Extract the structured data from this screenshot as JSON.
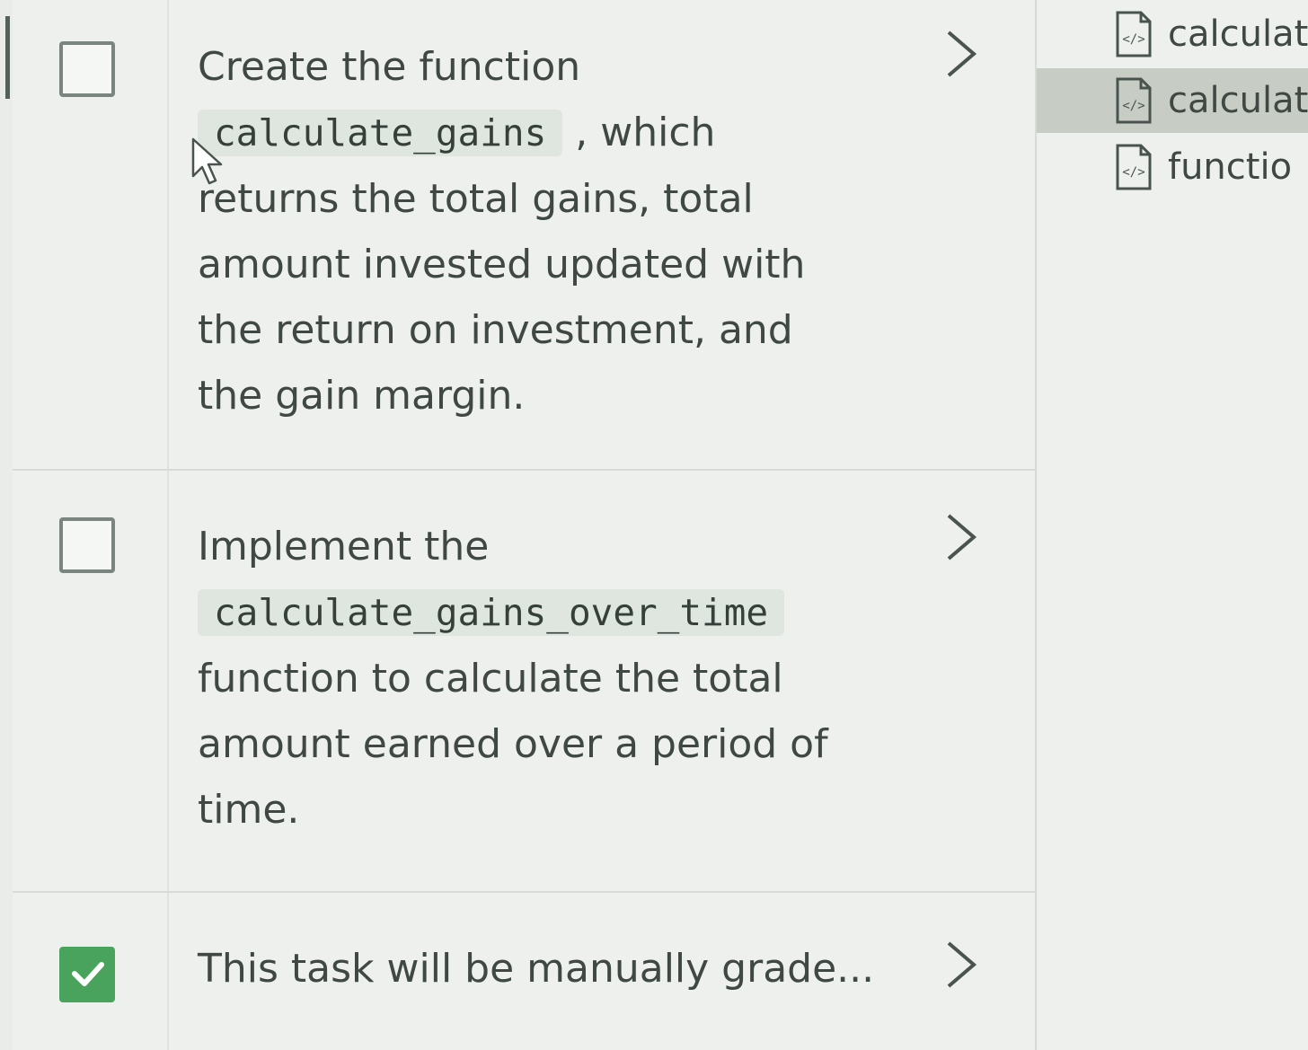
{
  "tasks": [
    {
      "checked": false,
      "parts": [
        "Create the function",
        "calculate_gains",
        ", which returns the total gains, total amount invested updated with the return on investment, and the gain margin."
      ]
    },
    {
      "checked": false,
      "parts": [
        "Implement the",
        "calculate_gains_over_time",
        "function to calculate the total amount earned over a period of time."
      ]
    },
    {
      "checked": true,
      "text": "This task will be manually grade..."
    }
  ],
  "files": [
    {
      "name": "calculat",
      "active": false,
      "icon": "code-file-icon"
    },
    {
      "name": "calculat",
      "active": true,
      "icon": "code-file-icon"
    },
    {
      "name": "functio",
      "active": false,
      "icon": "code-file-icon"
    }
  ],
  "colors": {
    "check_green": "#4aa35c",
    "active_file_bg": "#c7cdc4"
  }
}
